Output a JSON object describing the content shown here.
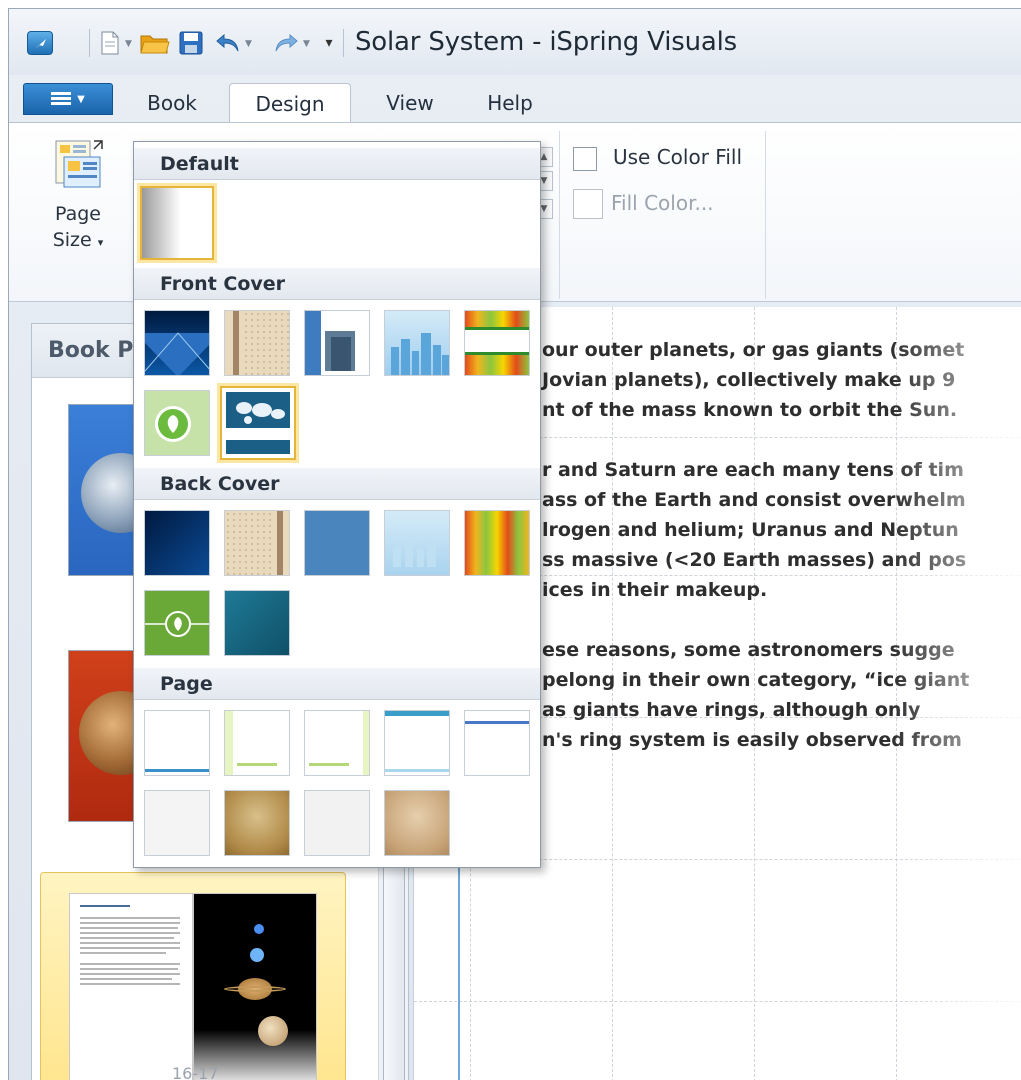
{
  "window": {
    "title": "Solar System - iSpring Visuals"
  },
  "quick_access": {
    "icons": [
      "app-icon",
      "new-document-icon",
      "open-folder-icon",
      "save-icon",
      "undo-icon",
      "redo-icon",
      "customize-arrow-icon"
    ]
  },
  "tabs": [
    {
      "label": "Book",
      "active": false
    },
    {
      "label": "Design",
      "active": true
    },
    {
      "label": "View",
      "active": false
    },
    {
      "label": "Help",
      "active": false
    }
  ],
  "ribbon": {
    "page_size_line1": "Page",
    "page_size_line2": "Size",
    "use_color_fill": "Use Color Fill",
    "fill_color": "Fill Color..."
  },
  "sidebar": {
    "title": "Book P",
    "selected_page_label": "16-17"
  },
  "gallery": {
    "sections": [
      "Default",
      "Front Cover",
      "Back Cover",
      "Page"
    ]
  },
  "canvas": {
    "paragraphs": [
      [
        "our outer planets, or gas giants (somet",
        " Jovian planets), collectively make up 9",
        "nt of the mass known to orbit the Sun."
      ],
      [
        "r and Saturn are each many tens of tim",
        "ass of the Earth and consist overwhelm",
        "lrogen and helium; Uranus and Neptun",
        "ss massive (<20 Earth masses) and pos",
        "ices in their makeup."
      ],
      [
        "ese reasons, some astronomers sugge",
        "pelong in their own category, “ice giant",
        "as giants have rings, although only",
        "n's ring system is easily observed from"
      ]
    ]
  },
  "colors": {
    "accent_blue": "#1c64ac",
    "selection_gold": "#e4b539",
    "selection_fill": "#ffe48a"
  }
}
